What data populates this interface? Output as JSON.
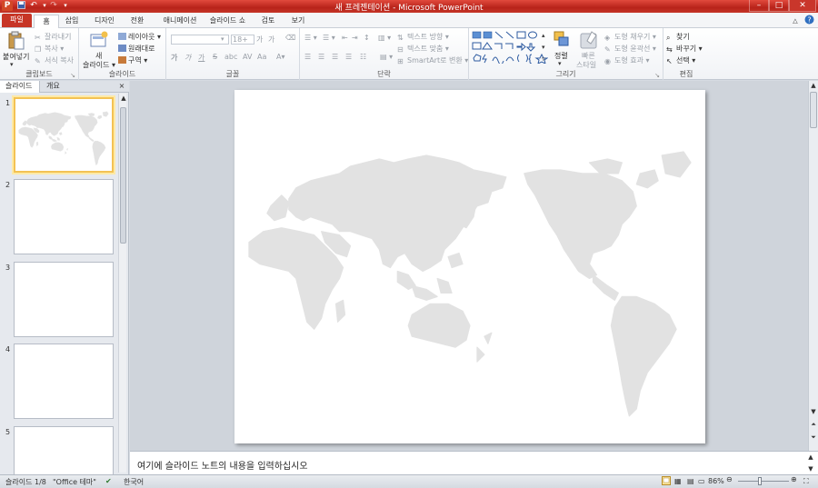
{
  "window": {
    "title": "새 프레젠테이션 - Microsoft PowerPoint",
    "logo_letter": "P"
  },
  "tabs": [
    {
      "label": "파일"
    },
    {
      "label": "홈"
    },
    {
      "label": "삽입"
    },
    {
      "label": "디자인"
    },
    {
      "label": "전환"
    },
    {
      "label": "애니메이션"
    },
    {
      "label": "슬라이드 쇼"
    },
    {
      "label": "검토"
    },
    {
      "label": "보기"
    }
  ],
  "ribbon": {
    "clipboard": {
      "label": "클립보드",
      "paste": "붙여넣기",
      "cut": "잘라내기",
      "copy": "복사",
      "format_painter": "서식 복사"
    },
    "slides": {
      "label": "슬라이드",
      "new_slide_line1": "새",
      "new_slide_line2": "슬라이드",
      "layout": "레이아웃",
      "reset": "원래대로",
      "section": "구역"
    },
    "font": {
      "label": "글꼴",
      "font_size": "18+",
      "bold": "가",
      "italic": "가",
      "underline": "가",
      "strike": "S",
      "shadow": "abc",
      "spacing": "AV",
      "case": "Aa"
    },
    "paragraph": {
      "label": "단락",
      "text_direction": "텍스트 방향",
      "align_text": "텍스트 맞춤",
      "smartart": "SmartArt로 변환"
    },
    "drawing": {
      "label": "그리기",
      "arrange": "정렬",
      "quick_styles_line1": "빠른",
      "quick_styles_line2": "스타일",
      "shape_fill": "도형 채우기",
      "shape_outline": "도형 윤곽선",
      "shape_effects": "도형 효과"
    },
    "editing": {
      "label": "편집",
      "find": "찾기",
      "replace": "바꾸기",
      "select": "선택"
    }
  },
  "slide_panel": {
    "tab_slides": "슬라이드",
    "tab_outline": "개요",
    "close": "×",
    "slides": [
      {
        "number": "1"
      },
      {
        "number": "2"
      },
      {
        "number": "3"
      },
      {
        "number": "4"
      },
      {
        "number": "5"
      }
    ]
  },
  "notes": {
    "placeholder": "여기에 슬라이드 노트의 내용을 입력하십시오"
  },
  "status": {
    "slide_info": "슬라이드 1/8",
    "theme": "\"Office 테마\"",
    "language": "한국어",
    "zoom": "86%"
  },
  "colors": {
    "accent": "#c73526",
    "map_land": "#e2e2e2"
  }
}
